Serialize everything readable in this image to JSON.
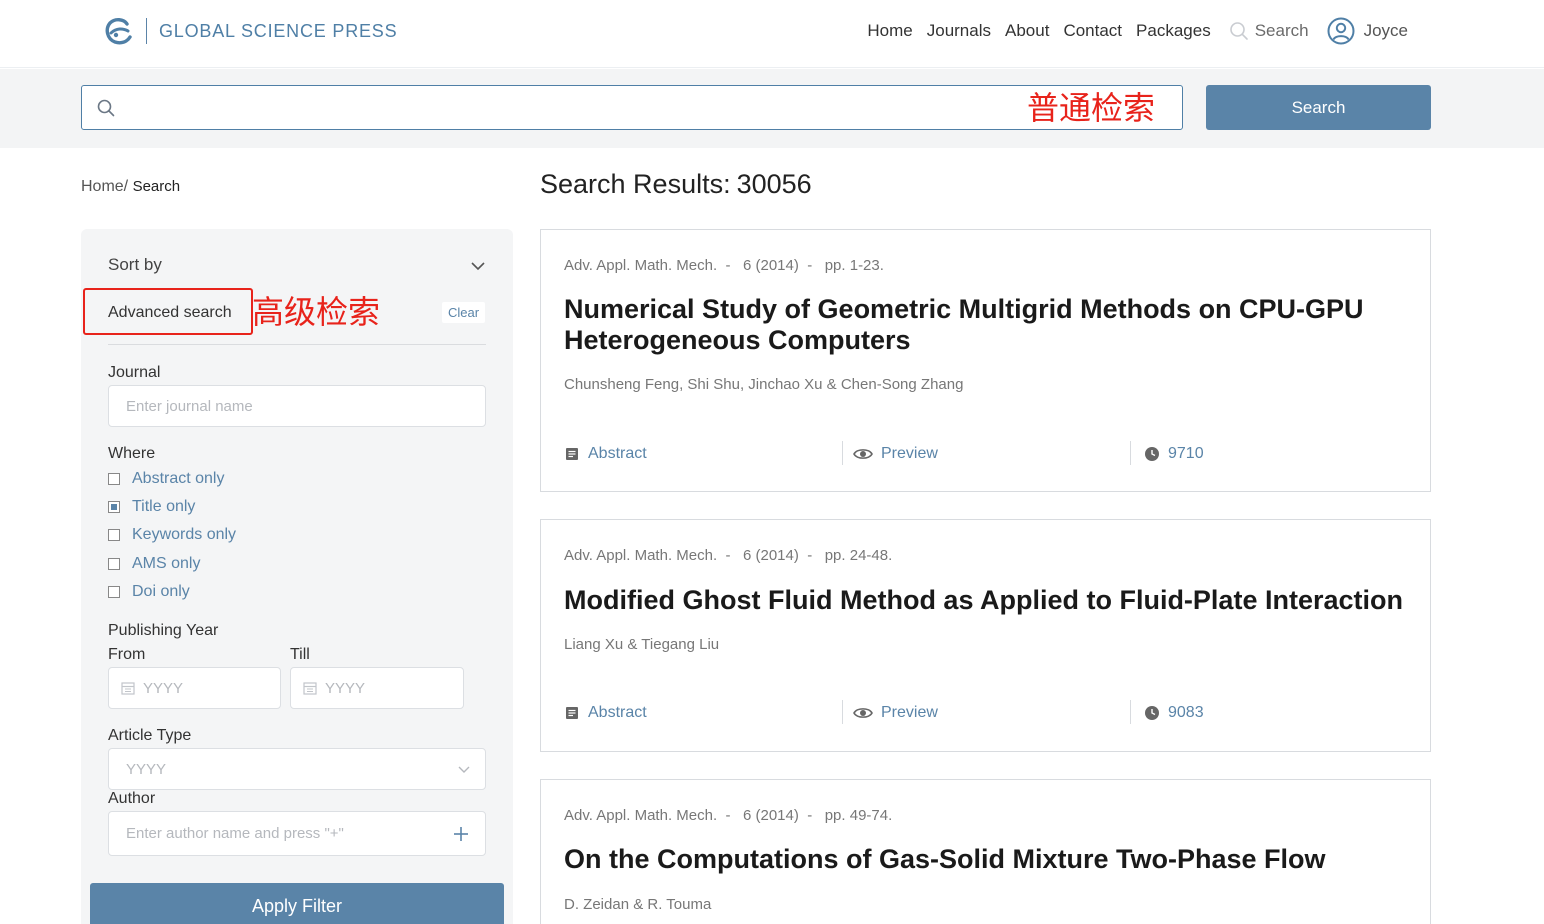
{
  "header": {
    "brand": "GLOBAL SCIENCE PRESS",
    "nav": [
      "Home",
      "Journals",
      "About",
      "Contact",
      "Packages"
    ],
    "search_label": "Search",
    "user_name": "Joyce"
  },
  "search": {
    "placeholder": "",
    "annotation": "普通检索",
    "button_label": "Search"
  },
  "breadcrumb": {
    "home": "Home/",
    "current": "Search"
  },
  "results": {
    "label": "Search Results:",
    "count": "30056"
  },
  "sidebar": {
    "sort_label": "Sort by",
    "advanced_label": "Advanced search",
    "advanced_annotation": "高级检索",
    "clear_label": "Clear",
    "journal_label": "Journal",
    "journal_placeholder": "Enter journal name",
    "where_label": "Where",
    "where_options": [
      {
        "label": "Abstract only",
        "checked": false
      },
      {
        "label": "Title only",
        "checked": true
      },
      {
        "label": "Keywords only",
        "checked": false
      },
      {
        "label": "AMS only",
        "checked": false
      },
      {
        "label": "Doi only",
        "checked": false
      }
    ],
    "year_label": "Publishing Year",
    "from_label": "From",
    "till_label": "Till",
    "year_placeholder": "YYYY",
    "type_label": "Article Type",
    "type_placeholder": "YYYY",
    "author_label": "Author",
    "author_placeholder": "Enter author name and press \"+\"",
    "apply_label": "Apply Filter"
  },
  "articles": [
    {
      "journal": "Adv. Appl. Math. Mech.",
      "volume": "6 (2014)",
      "pages": "pp. 1-23.",
      "title": "Numerical Study of Geometric Multigrid Methods on CPU-GPU Heterogeneous Computers",
      "authors": "Chunsheng Feng, Shi Shu, Jinchao Xu & Chen-Song Zhang",
      "abstract_label": "Abstract",
      "preview_label": "Preview",
      "views": "9710"
    },
    {
      "journal": "Adv. Appl. Math. Mech.",
      "volume": "6 (2014)",
      "pages": "pp. 24-48.",
      "title": "Modified Ghost Fluid Method as Applied to Fluid-Plate Interaction",
      "authors": "Liang Xu & Tiegang Liu",
      "abstract_label": "Abstract",
      "preview_label": "Preview",
      "views": "9083"
    },
    {
      "journal": "Adv. Appl. Math. Mech.",
      "volume": "6 (2014)",
      "pages": "pp. 49-74.",
      "title": "On the Computations of Gas-Solid Mixture Two-Phase Flow",
      "authors": "D. Zeidan & R. Touma"
    }
  ],
  "colors": {
    "accent": "#5a84a8",
    "annotation": "#e8231b",
    "band": "#f3f4f5"
  }
}
